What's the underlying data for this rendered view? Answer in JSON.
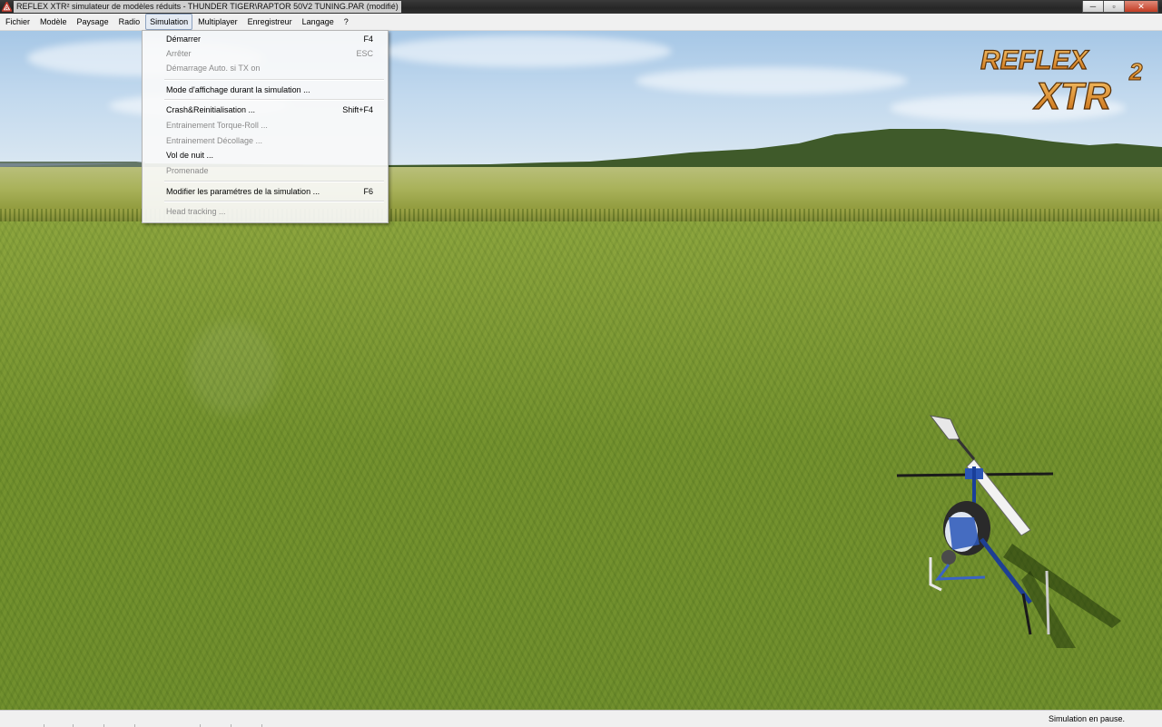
{
  "window": {
    "title": "REFLEX XTR² simulateur de modèles réduits - THUNDER TIGER\\RAPTOR 50V2 TUNING.PAR (modifié)",
    "minimize_glyph": "─",
    "maximize_glyph": "▫",
    "close_glyph": "✕"
  },
  "menubar": {
    "items": [
      "Fichier",
      "Modèle",
      "Paysage",
      "Radio",
      "Simulation",
      "Multiplayer",
      "Enregistreur",
      "Langage",
      "?"
    ],
    "active": "Simulation"
  },
  "simulation_menu": {
    "items": [
      {
        "label": "Démarrer",
        "shortcut": "F4",
        "enabled": true
      },
      {
        "label": "Arrêter",
        "shortcut": "ESC",
        "enabled": false
      },
      {
        "label": "Démarrage Auto. si TX on",
        "shortcut": "",
        "enabled": false
      },
      {
        "label": "Mode d'affichage durant la simulation ...",
        "shortcut": "",
        "enabled": true
      },
      {
        "label": "Crash&Reinitialisation ...",
        "shortcut": "Shift+F4",
        "enabled": true
      },
      {
        "label": "Entrainement Torque-Roll ...",
        "shortcut": "",
        "enabled": false
      },
      {
        "label": "Entrainement Décollage ...",
        "shortcut": "",
        "enabled": false
      },
      {
        "label": "Vol de nuit ...",
        "shortcut": "",
        "enabled": true
      },
      {
        "label": "Promenade",
        "shortcut": "",
        "enabled": false
      },
      {
        "label": "Modifier les paramétres de la simulation ...",
        "shortcut": "F6",
        "enabled": true
      },
      {
        "label": "Head tracking ...",
        "shortcut": "",
        "enabled": false
      }
    ]
  },
  "logo": {
    "line1": "REFLEX",
    "line2": "XTR",
    "superscript": "2"
  },
  "statusbar": {
    "text": "Simulation en pause."
  },
  "icons": {
    "app": "app-warning-triangle-icon"
  },
  "colors": {
    "accent": "#e08a1e",
    "menu_active_bg": "#e4eaf3",
    "disabled_text": "#8a8a8a"
  }
}
